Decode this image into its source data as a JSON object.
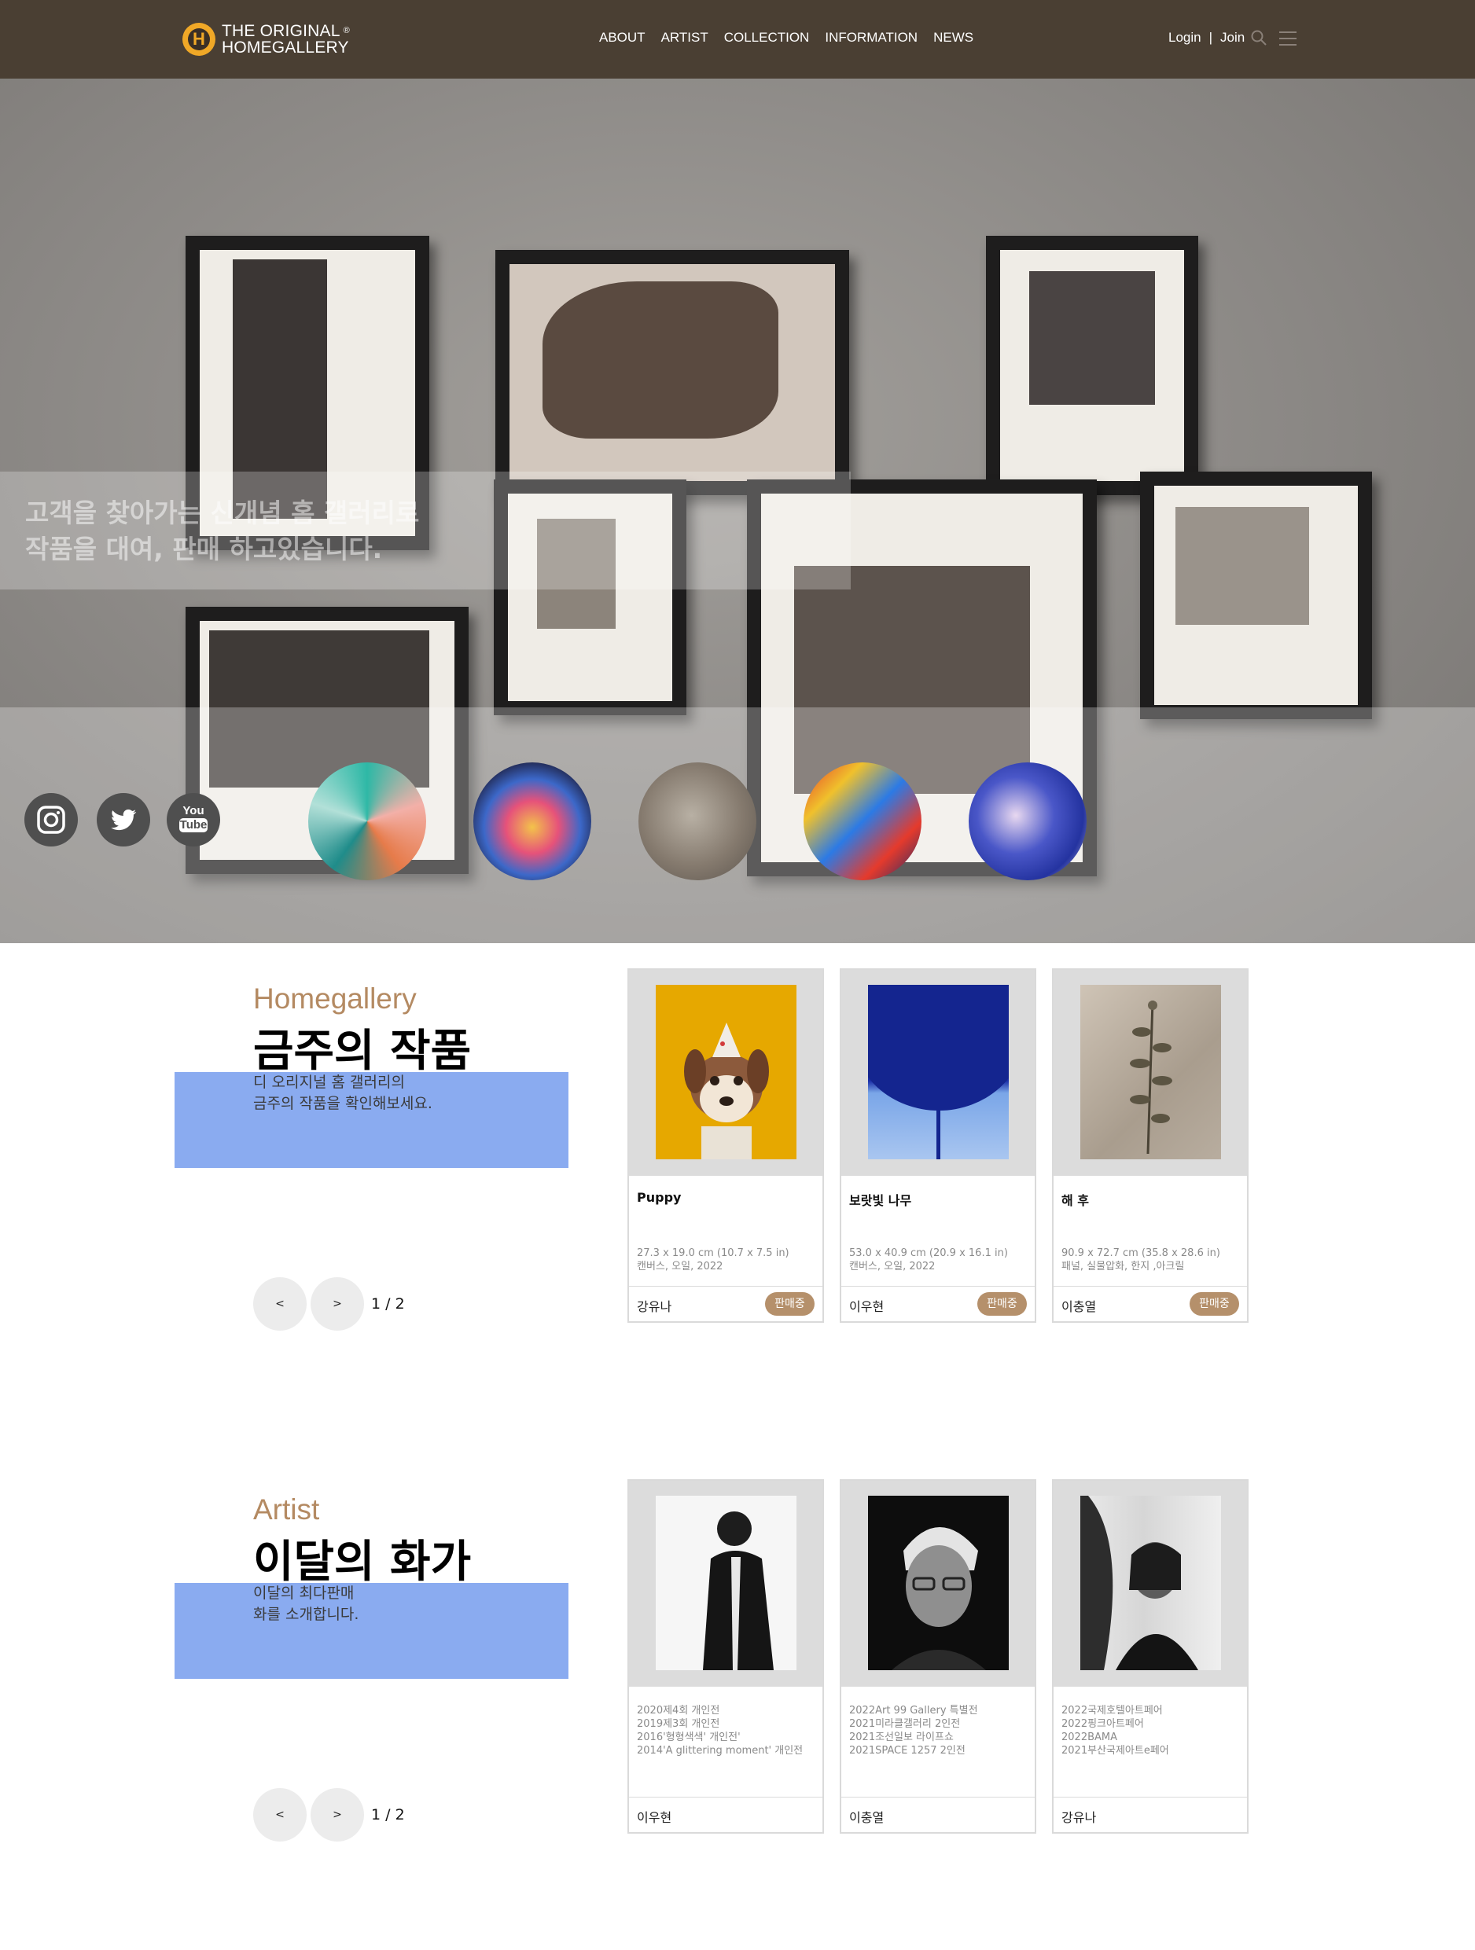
{
  "header": {
    "logo_line1": "THE ORIGINAL",
    "logo_line2": "HOMEGALLERY",
    "logo_reg": "®",
    "nav": [
      "ABOUT",
      "ARTIST",
      "COLLECTION",
      "INFORMATION",
      "NEWS"
    ],
    "login": "Login",
    "separator": "|",
    "join": "Join"
  },
  "hero": {
    "headline_line1": "고객을 찾아가는 신개념 홈 갤러리로",
    "headline_line2": "작품을 대여, 판매 하고있습니다.",
    "social": [
      "instagram-icon",
      "twitter-icon",
      "youtube-icon"
    ],
    "youtube_label_1": "You",
    "youtube_label_2": "Tube"
  },
  "weekly": {
    "subtitle": "Homegallery",
    "title": "금주의 작품",
    "desc_line1": "디 오리지널 홈 갤러리의",
    "desc_line2": "금주의 작품을 확인해보세요.",
    "prev": "<",
    "next": ">",
    "page": "1 / 2",
    "cards": [
      {
        "title": "Puppy",
        "size": "27.3 x 19.0 cm (10.7 x 7.5 in)",
        "medium": "캔버스, 오일, 2022",
        "artist": "강유나",
        "badge": "판매중"
      },
      {
        "title": "보랏빛 나무",
        "size": "53.0 x 40.9 cm (20.9 x 16.1 in)",
        "medium": "캔버스, 오일, 2022",
        "artist": "이우현",
        "badge": "판매중"
      },
      {
        "title": "해 후",
        "size": "90.9 x 72.7 cm (35.8 x 28.6 in)",
        "medium": "패널, 실물압화, 한지 ,아크릴",
        "artist": "이충열",
        "badge": "판매중"
      }
    ]
  },
  "artists": {
    "subtitle": "Artist",
    "title": "이달의 화가",
    "desc_line1": "이달의 최다판매",
    "desc_line2": "화를 소개합니다.",
    "prev": "<",
    "next": ">",
    "page": "1 / 2",
    "cards": [
      {
        "lines": [
          "2020제4회 개인전",
          "2019제3회 개인전",
          "2016'형형색색' 개인전'",
          "2014'A glittering moment' 개인전"
        ],
        "name": "이우현"
      },
      {
        "lines": [
          "2022Art 99 Gallery 특별전",
          "2021미라클갤러리 2인전",
          "2021조선일보 라이프쇼",
          "2021SPACE 1257 2인전"
        ],
        "name": "이충열"
      },
      {
        "lines": [
          "2022국제호텔아트페어",
          "2022핑크아트페어",
          "2022BAMA",
          "2021부산국제아트e페어"
        ],
        "name": "강유나"
      }
    ]
  }
}
